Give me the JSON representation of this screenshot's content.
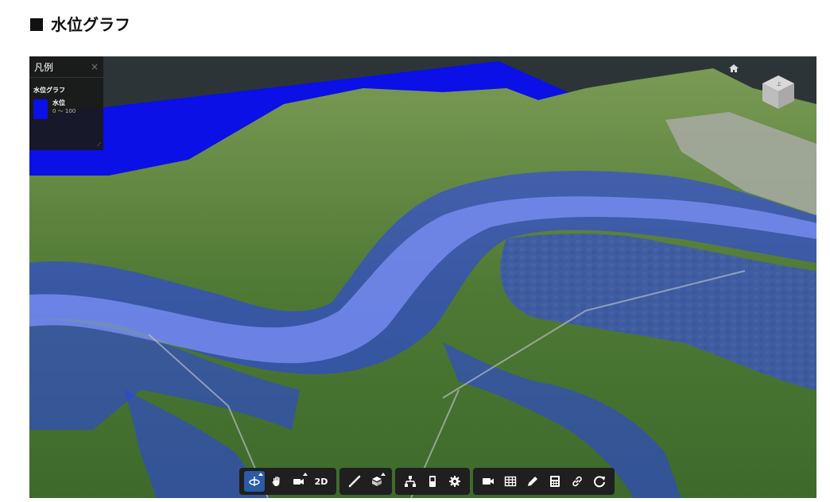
{
  "page": {
    "title": "■ 水位グラフ",
    "title_text": "水位グラフ"
  },
  "legend": {
    "title": "凡例",
    "close_glyph": "×",
    "layer_name": "水位グラフ",
    "items": [
      {
        "label": "水位",
        "range": "0 〜 100",
        "color": "#0a10e6"
      }
    ]
  },
  "colors": {
    "water": "#0a10e6",
    "flood_overlay": "rgba(40,60,255,0.55)",
    "toolbar_bg": "#1f1f1f",
    "active": "#2b5aa8"
  },
  "toolbar": {
    "groups": [
      {
        "items": [
          {
            "icon": "rotate-icon",
            "active": true
          },
          {
            "icon": "hand-icon"
          },
          {
            "icon": "camera-move-icon"
          },
          {
            "text": "2D"
          }
        ]
      },
      {
        "items": [
          {
            "icon": "ruler-icon"
          },
          {
            "icon": "box-layer-icon"
          }
        ]
      },
      {
        "items": [
          {
            "icon": "hierarchy-icon"
          },
          {
            "icon": "device-icon"
          },
          {
            "icon": "settings-icon"
          }
        ]
      },
      {
        "items": [
          {
            "icon": "video-camera-icon"
          },
          {
            "icon": "table-icon"
          },
          {
            "icon": "pencil-icon"
          },
          {
            "icon": "calculator-icon"
          },
          {
            "icon": "link-icon"
          },
          {
            "icon": "refresh-icon"
          }
        ]
      }
    ]
  }
}
